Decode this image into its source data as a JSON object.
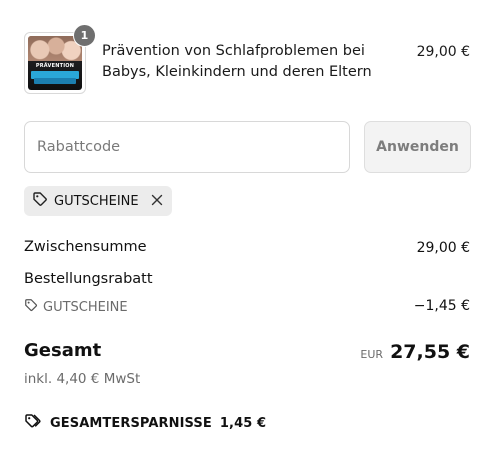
{
  "product": {
    "quantity": "1",
    "title": "Prävention von Schlafproblemen bei Babys, Kleinkindern und deren Eltern",
    "price": "29,00 €",
    "thumbnail_title": "PRÄVENTION"
  },
  "discount": {
    "placeholder": "Rabattcode",
    "apply_label": "Anwenden",
    "applied_code": "GUTSCHEINE"
  },
  "summary": {
    "subtotal_label": "Zwischensumme",
    "subtotal_value": "29,00 €",
    "order_discount_label": "Bestellungsrabatt",
    "discount_code": "GUTSCHEINE",
    "discount_value": "−1,45 €",
    "total_label": "Gesamt",
    "currency": "EUR",
    "total_value": "27,55 €",
    "tax_note": "inkl. 4,40 € MwSt",
    "savings_label": "GESAMTERSPARNISSE",
    "savings_value": "1,45 €"
  },
  "icons": {
    "tag": "tag-icon",
    "tags": "tags-icon",
    "close": "close-icon"
  }
}
